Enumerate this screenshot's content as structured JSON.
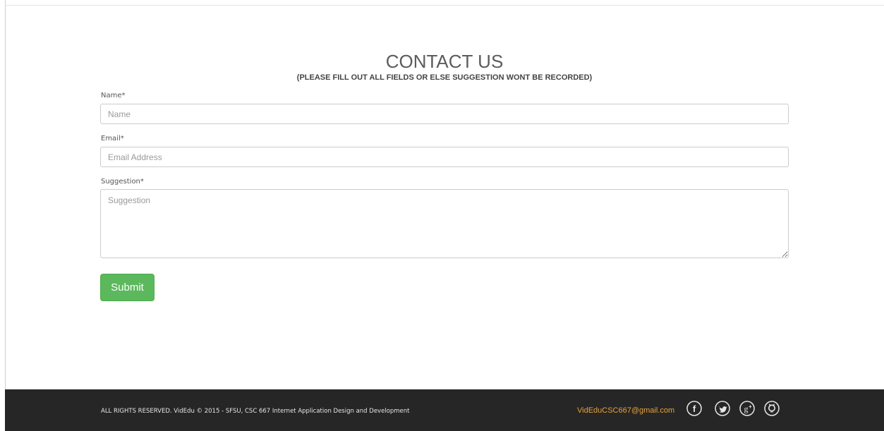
{
  "header": {
    "title": "CONTACT US",
    "subtitle": "(PLEASE FILL OUT ALL FIELDS OR ELSE SUGGESTION WONT BE RECORDED)"
  },
  "form": {
    "name": {
      "label": "Name*",
      "placeholder": "Name",
      "value": ""
    },
    "email": {
      "label": "Email*",
      "placeholder": "Email Address",
      "value": ""
    },
    "suggestion": {
      "label": "Suggestion*",
      "placeholder": "Suggestion",
      "value": ""
    },
    "submit_label": "Submit"
  },
  "footer": {
    "copyright": "ALL RIGHTS RESERVED. VidEdu © 2015 - SFSU, CSC 667 Internet Application Design and Development",
    "email": "VidEduCSC667@gmail.com",
    "social_icons": [
      "facebook-icon",
      "twitter-icon",
      "google-plus-icon",
      "github-icon"
    ]
  },
  "colors": {
    "submit_button": "#5cb85c",
    "footer_background": "#262626",
    "footer_email": "#e8a23a"
  }
}
